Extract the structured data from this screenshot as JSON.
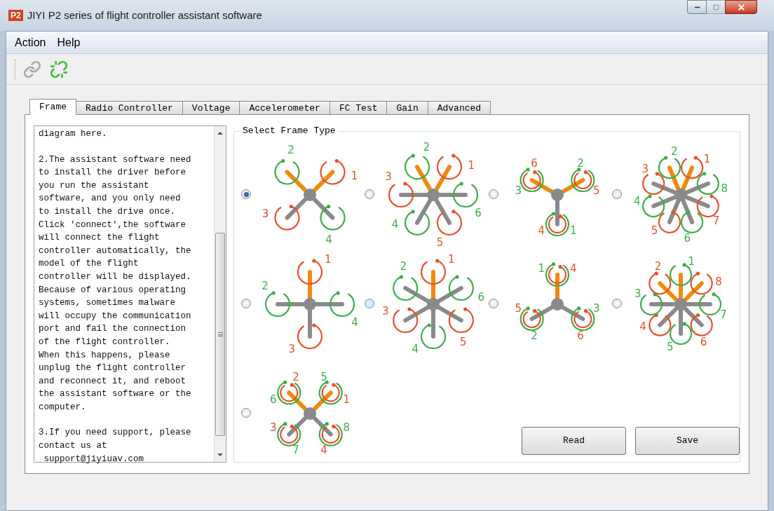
{
  "window": {
    "title": "JIYI P2 series of flight controller assistant software",
    "app_badge": "P2"
  },
  "menu": [
    "Action",
    "Help"
  ],
  "toolbar": [
    {
      "kind": "connect",
      "disabled": true
    },
    {
      "kind": "disconnect",
      "disabled": false
    }
  ],
  "tabs": [
    {
      "label": "Frame",
      "selected": true
    },
    {
      "label": "Radio Controller",
      "selected": false
    },
    {
      "label": "Voltage",
      "selected": false
    },
    {
      "label": "Accelerometer",
      "selected": false
    },
    {
      "label": "FC Test",
      "selected": false
    },
    {
      "label": "Gain",
      "selected": false
    },
    {
      "label": "Advanced",
      "selected": false
    }
  ],
  "help_text": [
    "diagram here.",
    "2.The assistant software need\nto install the driver before\nyou run the assistant\nsoftware, and you only need\nto install the drive once.\nClick 'connect',the software\nwill connect the flight\ncontroller automatically, the\nmodel of the flight\ncontroller will be displayed.\nBecause of various operating\nsystems, sometimes malware\nwill occupy the communication\nport and fail the connection\nof the flight controller.\nWhen this happens, please\nunplug the flight controller\nand reconnect it, and reboot\nthe assistant software or the\ncomputer.",
    "3.If you need support, please\ncontact us at\n support@jiyiuav.com"
  ],
  "frame_group": {
    "title": "Select Frame Type",
    "frames": [
      {
        "kind": "quad_x",
        "selected": true,
        "hovered": false,
        "motors": [
          {
            "label": "1",
            "color": "#e8502a"
          },
          {
            "label": "4",
            "color": "#3aae4a"
          },
          {
            "label": "3",
            "color": "#e8502a"
          },
          {
            "label": "2",
            "color": "#3aae4a"
          }
        ]
      },
      {
        "kind": "hexa_x",
        "selected": false,
        "hovered": false,
        "motors": [
          {
            "label": "1",
            "color": "#e8502a"
          },
          {
            "label": "6",
            "color": "#3aae4a"
          },
          {
            "label": "5",
            "color": "#e8502a"
          },
          {
            "label": "4",
            "color": "#3aae4a"
          },
          {
            "label": "3",
            "color": "#e8502a"
          },
          {
            "label": "2",
            "color": "#3aae4a"
          }
        ]
      },
      {
        "kind": "y6",
        "selected": false,
        "hovered": false,
        "motors": [
          {
            "label": "5",
            "color": "#e8502a"
          },
          {
            "label": "2",
            "color": "#3aae4a"
          },
          {
            "label": "4",
            "color": "#e8502a"
          },
          {
            "label": "1",
            "color": "#3aae4a"
          },
          {
            "label": "6",
            "color": "#e8502a"
          },
          {
            "label": "3",
            "color": "#3aae4a"
          }
        ]
      },
      {
        "kind": "octo_x",
        "selected": false,
        "hovered": false,
        "motors": [
          {
            "label": "1",
            "color": "#e8502a"
          },
          {
            "label": "8",
            "color": "#3aae4a"
          },
          {
            "label": "7",
            "color": "#e8502a"
          },
          {
            "label": "6",
            "color": "#3aae4a"
          },
          {
            "label": "5",
            "color": "#e8502a"
          },
          {
            "label": "4",
            "color": "#3aae4a"
          },
          {
            "label": "3",
            "color": "#e8502a"
          },
          {
            "label": "2",
            "color": "#3aae4a"
          }
        ]
      },
      {
        "kind": "quad_plus",
        "selected": false,
        "hovered": false,
        "motors": [
          {
            "label": "1",
            "color": "#e8502a"
          },
          {
            "label": "4",
            "color": "#3aae4a"
          },
          {
            "label": "3",
            "color": "#e8502a"
          },
          {
            "label": "2",
            "color": "#3aae4a"
          }
        ]
      },
      {
        "kind": "hexa_plus",
        "selected": false,
        "hovered": true,
        "motors": [
          {
            "label": "1",
            "color": "#e8502a"
          },
          {
            "label": "6",
            "color": "#3aae4a"
          },
          {
            "label": "5",
            "color": "#e8502a"
          },
          {
            "label": "4",
            "color": "#3aae4a"
          },
          {
            "label": "3",
            "color": "#e8502a"
          },
          {
            "label": "2",
            "color": "#3aae4a"
          }
        ]
      },
      {
        "kind": "y6_inverted",
        "selected": false,
        "hovered": false,
        "motors": [
          {
            "label": "4",
            "color": "#e8502a"
          },
          {
            "label": "1",
            "color": "#3aae4a"
          },
          {
            "label": "6",
            "color": "#e8502a"
          },
          {
            "label": "3",
            "color": "#3aae4a"
          },
          {
            "label": "5",
            "color": "#e8502a"
          },
          {
            "label": "2",
            "color": "#3aae4a"
          }
        ]
      },
      {
        "kind": "octo_plus",
        "selected": false,
        "hovered": false,
        "motors": [
          {
            "label": "1",
            "color": "#3aae4a"
          },
          {
            "label": "8",
            "color": "#e8502a"
          },
          {
            "label": "7",
            "color": "#3aae4a"
          },
          {
            "label": "6",
            "color": "#e8502a"
          },
          {
            "label": "5",
            "color": "#3aae4a"
          },
          {
            "label": "4",
            "color": "#e8502a"
          },
          {
            "label": "3",
            "color": "#3aae4a"
          },
          {
            "label": "2",
            "color": "#e8502a"
          }
        ]
      },
      {
        "kind": "x8",
        "selected": false,
        "hovered": false,
        "motors": [
          {
            "label": "1",
            "color": "#e8502a"
          },
          {
            "label": "5",
            "color": "#3aae4a"
          },
          {
            "label": "4",
            "color": "#e8502a"
          },
          {
            "label": "8",
            "color": "#3aae4a"
          },
          {
            "label": "3",
            "color": "#e8502a"
          },
          {
            "label": "7",
            "color": "#3aae4a"
          },
          {
            "label": "2",
            "color": "#e8502a"
          },
          {
            "label": "6",
            "color": "#3aae4a"
          }
        ]
      }
    ]
  },
  "buttons": [
    "Read",
    "Save"
  ]
}
